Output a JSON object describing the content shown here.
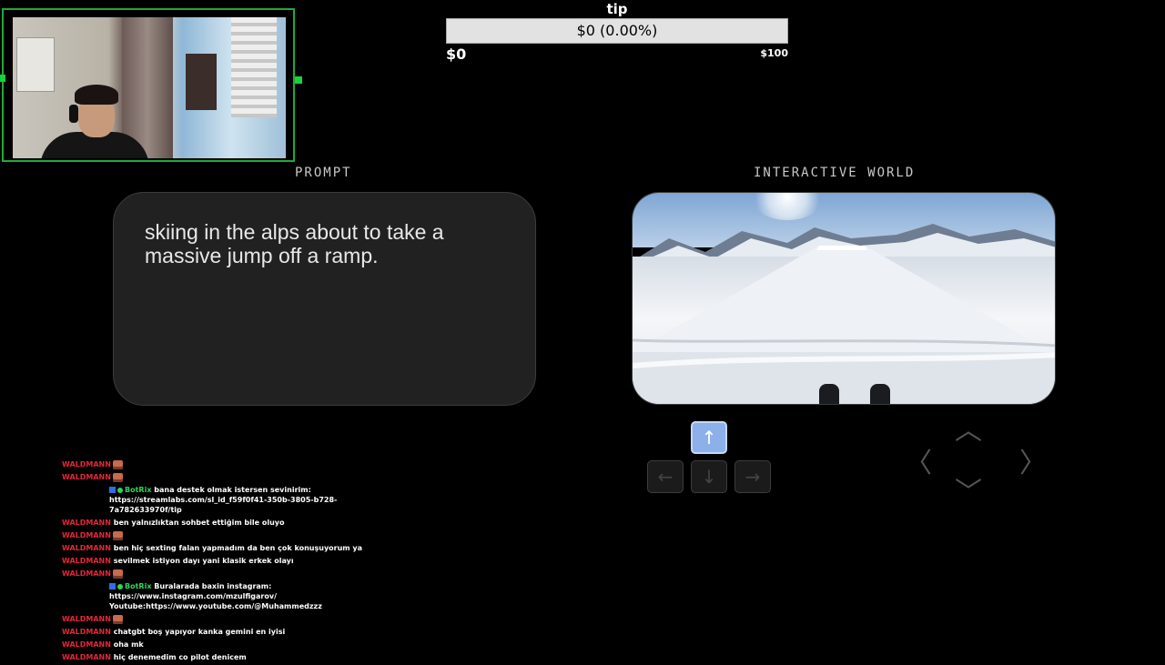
{
  "tip": {
    "title": "tip",
    "progress_text": "$0 (0.00%)",
    "progress_fraction": 0.0,
    "min_label": "$0",
    "max_label": "$100",
    "fill_color": "#3ac45a"
  },
  "sections": {
    "prompt_label": "PROMPT",
    "world_label": "INTERACTIVE WORLD"
  },
  "prompt": {
    "text": "skiing in the alps about to take a massive jump off a ramp."
  },
  "controls": {
    "up": "↑",
    "left": "←",
    "down": "↓",
    "right": "→",
    "active_key": "up",
    "cam_up": "︿",
    "cam_down": "﹀",
    "cam_left": "〈",
    "cam_right": "〉"
  },
  "chat": {
    "messages": [
      {
        "user": "WALDMANN",
        "text": "",
        "emote": true
      },
      {
        "user": "WALDMANN",
        "text": "",
        "emote": true
      },
      {
        "user": "BotRix",
        "bot": true,
        "text": "bana destek olmak istersen sevinirim:",
        "cont": [
          "https://streamlabs.com/sl_id_f59f0f41-350b-3805-b728-",
          "7a782633970f/tip"
        ]
      },
      {
        "user": "WALDMANN",
        "text": "ben yalnızlıktan sohbet ettiğim bile oluyo"
      },
      {
        "user": "WALDMANN",
        "text": "",
        "emote": true
      },
      {
        "user": "WALDMANN",
        "text": "ben hiç sexting falan yapmadım da ben çok konuşuyorum ya"
      },
      {
        "user": "WALDMANN",
        "text": "sevilmek istiyon dayı yani klasik erkek olayı"
      },
      {
        "user": "WALDMANN",
        "text": "",
        "emote": true
      },
      {
        "user": "BotRix",
        "bot": true,
        "text": "Buralarada baxin instagram: https://www.instagram.com/mzulfigarov/",
        "cont": [
          "Youtube:https://www.youtube.com/@Muhammedzzz"
        ]
      },
      {
        "user": "WALDMANN",
        "text": "",
        "emote": true
      },
      {
        "user": "WALDMANN",
        "text": "chatgbt boş yapıyor kanka gemini en iyisi"
      },
      {
        "user": "WALDMANN",
        "text": "oha mk"
      },
      {
        "user": "WALDMANN",
        "text": "hiç denemedim co pilot denicem"
      }
    ]
  }
}
